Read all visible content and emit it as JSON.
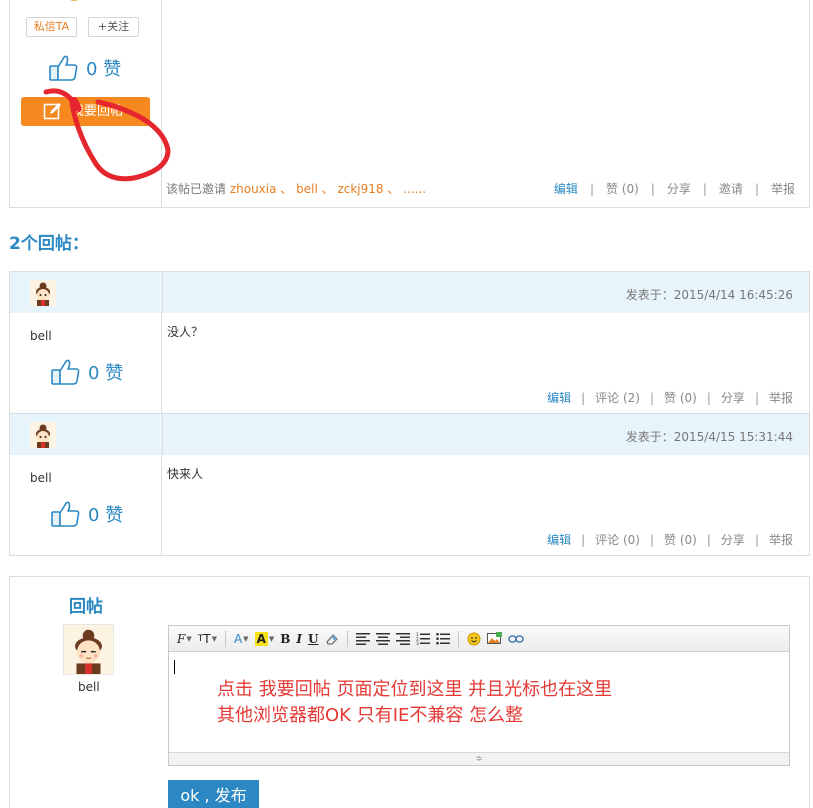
{
  "top_post": {
    "pm_label": "私信TA",
    "follow_label": "+关注",
    "like_count": "0",
    "like_unit": "赞",
    "reply_button": "我要回帖",
    "invite_prefix": "该帖已邀请 ",
    "invited": [
      "zhouxia",
      "bell",
      "zckj918",
      "......"
    ],
    "invite_sep": " 、",
    "actions": {
      "edit": "编辑",
      "like": "赞 (0)",
      "share": "分享",
      "invite": "邀请",
      "report": "举报"
    }
  },
  "replies_title": "2个回帖：",
  "replies": [
    {
      "posted": "发表于：2015/4/14 16:45:26",
      "user": "bell",
      "like_count": "0",
      "like_unit": "赞",
      "content": "没人？",
      "actions": {
        "edit": "编辑",
        "comment": "评论 (2)",
        "like": "赞 (0)",
        "share": "分享",
        "report": "举报"
      }
    },
    {
      "posted": "发表于：2015/4/15 15:31:44",
      "user": "bell",
      "like_count": "0",
      "like_unit": "赞",
      "content": "快来人",
      "actions": {
        "edit": "编辑",
        "comment": "评论 (0)",
        "like": "赞 (0)",
        "share": "分享",
        "report": "举报"
      }
    }
  ],
  "reply_form": {
    "label": "回帖",
    "user": "bell",
    "annotation_line1": "点击 我要回帖  页面定位到这里 并且光标也在这里",
    "annotation_line2": "其他浏览器都OK 只有IE不兼容 怎么整",
    "submit": "ok , 发布"
  },
  "colors": {
    "accent": "#2b88c2",
    "orange": "#f5881f",
    "annotation": "#e53935",
    "header_bg": "#e8f4fb"
  }
}
